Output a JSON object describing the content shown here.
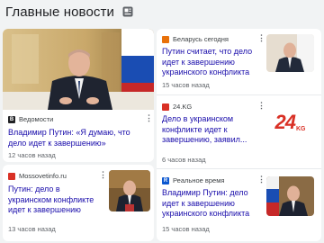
{
  "header": {
    "title": "Главные новости",
    "icon": "feed-icon"
  },
  "articles": [
    {
      "source": "Ведомости",
      "headline": "Владимир Путин: «Я думаю, что дело идет к завершению»",
      "time": "12 часов назад",
      "logo_letter": "В",
      "logo_color": "#202124"
    },
    {
      "source": "Беларусь сегодня",
      "headline": "Путин считает, что дело идет к завершению украинского конфликта",
      "time": "15 часов назад",
      "logo_color": "#e8710a"
    },
    {
      "source": "24.KG",
      "headline": "Дело в украинском конфликте идет к завершению, заявил...",
      "time": "6 часов назад",
      "logo_color": "#d93025",
      "thumb_text": "24",
      "thumb_sub": "KG"
    },
    {
      "source": "Mossovetinfo.ru",
      "headline": "Путин: дело в украинском конфликте идет к завершению",
      "time": "13 часов назад",
      "logo_color": "#1a73e8"
    },
    {
      "source": "Реальное время",
      "headline": "Владимир Путин: дело идет к завершению украинского конфликта",
      "time": "15 часов назад",
      "logo_letter": "R",
      "logo_color": "#0b57d0"
    }
  ],
  "more_label": "⋮"
}
